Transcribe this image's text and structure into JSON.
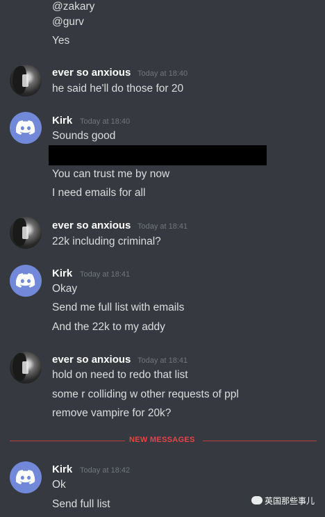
{
  "messages_top": [
    "@zakary",
    "@gurv",
    "Yes"
  ],
  "groups": [
    {
      "author": "ever so anxious",
      "time": "Today at 18:40",
      "lines": [
        "he said he'll do those for 20"
      ]
    },
    {
      "author": "Kirk",
      "time": "Today at 18:40",
      "lines": [
        "Sounds good",
        "You can trust me by now",
        "I need emails for all"
      ]
    },
    {
      "author": "ever so anxious",
      "time": "Today at 18:41",
      "lines": [
        "22k including criminal?"
      ]
    },
    {
      "author": "Kirk",
      "time": "Today at 18:41",
      "lines": [
        "Okay",
        "Send me full list with emails",
        "And the 22k to my addy"
      ]
    },
    {
      "author": "ever so anxious",
      "time": "Today at 18:41",
      "lines": [
        "hold on need to redo that list",
        "some r colliding w other requests of ppl",
        "remove vampire for 20k?"
      ]
    },
    {
      "author": "Kirk",
      "time": "Today at 18:42",
      "lines": [
        "Ok",
        "Send full list"
      ]
    }
  ],
  "divider": {
    "label": "NEW MESSAGES",
    "color": "#ed4245"
  },
  "watermark": "英国那些事儿",
  "colors": {
    "background": "#36393f",
    "text": "#dcddde",
    "username": "#ffffff",
    "timestamp": "#72767d",
    "discord_avatar": "#7289da"
  }
}
